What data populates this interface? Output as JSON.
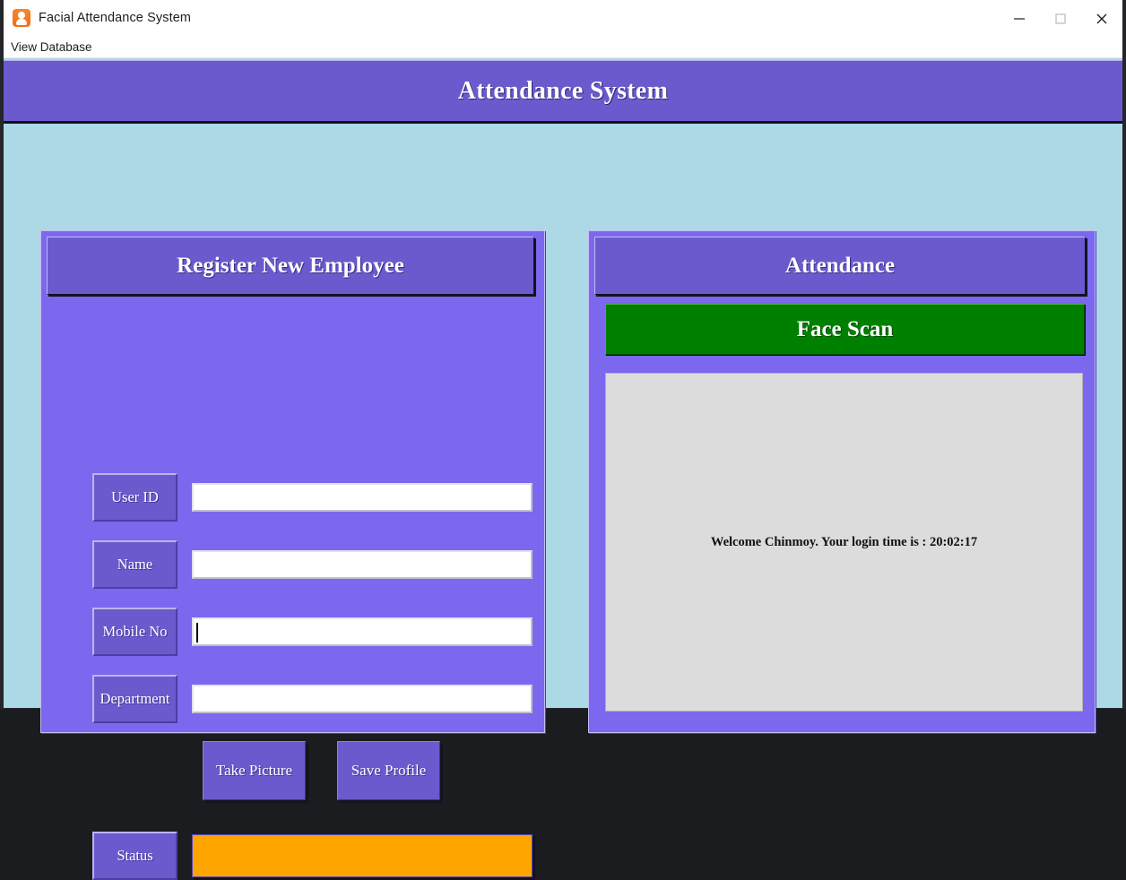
{
  "window": {
    "title": "Facial Attendance System",
    "app_icon": "face-scan-app-icon",
    "controls": {
      "minimize": "minimize-icon",
      "maximize": "maximize-icon",
      "close": "close-icon"
    }
  },
  "menubar": {
    "items": [
      {
        "label": "View Database"
      }
    ]
  },
  "banner": {
    "title": "Attendance System"
  },
  "register_panel": {
    "header": "Register New Employee",
    "fields": [
      {
        "label": "User ID",
        "value": "",
        "placeholder": "",
        "focused": false
      },
      {
        "label": "Name",
        "value": "",
        "placeholder": "",
        "focused": false
      },
      {
        "label": "Mobile No",
        "value": "",
        "placeholder": "",
        "focused": true
      },
      {
        "label": "Department",
        "value": "",
        "placeholder": "",
        "focused": false
      }
    ],
    "buttons": [
      {
        "label": "Take Picture"
      },
      {
        "label": "Save Profile"
      }
    ],
    "status": {
      "label": "Status",
      "value": ""
    }
  },
  "attendance_panel": {
    "header": "Attendance",
    "scan_button": "Face Scan",
    "video_message": "Welcome Chinmoy. Your login time is : 20:02:17"
  },
  "colors": {
    "app_background": "#add8e6",
    "panel_background": "#7b68ee",
    "header_purple": "#6a5acd",
    "scan_green": "#008000",
    "status_orange": "#ffa500",
    "video_gray": "#dcdcdc",
    "title_icon_orange": "#f2781f"
  }
}
